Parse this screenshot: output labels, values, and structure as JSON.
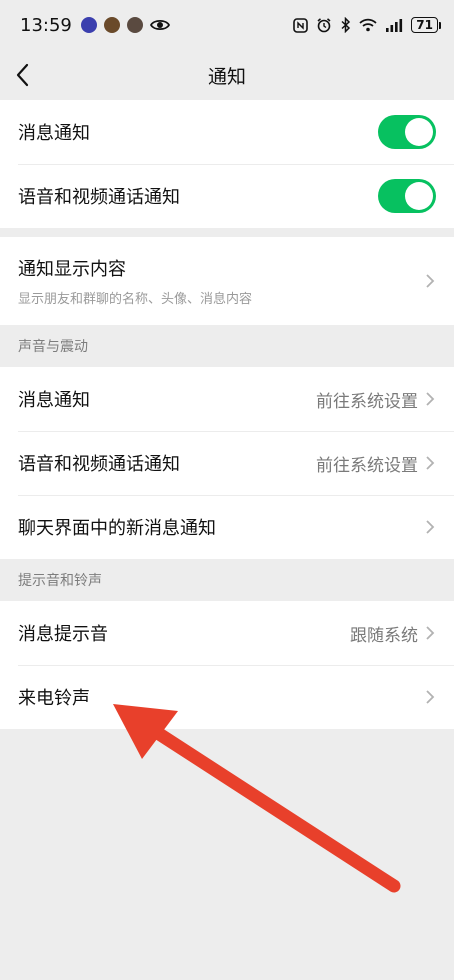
{
  "status_bar": {
    "time": "13:59",
    "battery": "71",
    "app_dot_colors": [
      "#3b3fae",
      "#6a4a2a",
      "#5a4a40"
    ]
  },
  "nav": {
    "title": "通知"
  },
  "notifications": {
    "message_label": "消息通知",
    "call_label": "语音和视频通话通知",
    "message_on": true,
    "call_on": true
  },
  "display": {
    "label": "通知显示内容",
    "sublabel": "显示朋友和群聊的名称、头像、消息内容"
  },
  "sound_vibration": {
    "header": "声音与震动",
    "message_label": "消息通知",
    "message_value": "前往系统设置",
    "call_label": "语音和视频通话通知",
    "call_value": "前往系统设置",
    "chat_label": "聊天界面中的新消息通知"
  },
  "ringtones": {
    "header": "提示音和铃声",
    "message_tone_label": "消息提示音",
    "message_tone_value": "跟随系统",
    "ringtone_label": "来电铃声"
  },
  "colors": {
    "accent": "#07c160",
    "arrow": "#e8402b"
  }
}
